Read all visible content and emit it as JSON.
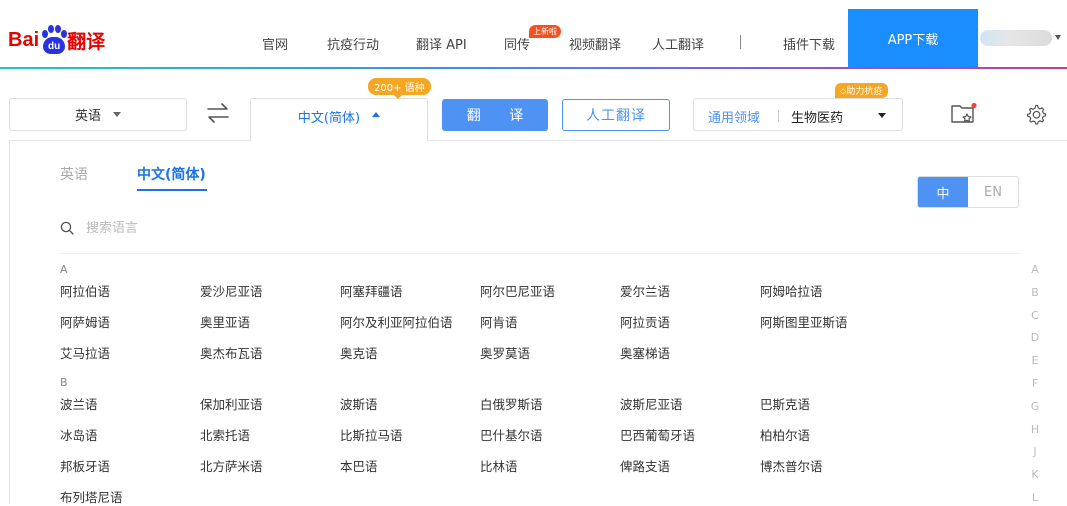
{
  "logo": {
    "bai": "Bai",
    "du": "du",
    "fanyi": "翻译"
  },
  "nav": {
    "items": [
      "官网",
      "抗疫行动",
      "翻译 API",
      "同传",
      "视频翻译",
      "人工翻译",
      "插件下载"
    ],
    "new_badge": "上新啦",
    "app_download": "APP下载"
  },
  "toolbar": {
    "source_lang": "英语",
    "target_lang": "中文(简体)",
    "lang_count_badge": "200+ 语种",
    "translate_label": "翻 译",
    "human_label": "人工翻译",
    "domain_label": "通用领域",
    "domain_value": "生物医药",
    "help_badge": "助力抗疫"
  },
  "panel": {
    "tabs": [
      "英语",
      "中文(简体)"
    ],
    "toggle": {
      "zh": "中",
      "en": "EN"
    },
    "search_placeholder": "搜索语言",
    "groups": [
      {
        "letter": "A",
        "rows": [
          [
            "阿拉伯语",
            "爱沙尼亚语",
            "阿塞拜疆语",
            "阿尔巴尼亚语",
            "爱尔兰语",
            "阿姆哈拉语"
          ],
          [
            "阿萨姆语",
            "奥里亚语",
            "阿尔及利亚阿拉伯语",
            "阿肯语",
            "阿拉贡语",
            "阿斯图里亚斯语"
          ],
          [
            "艾马拉语",
            "奥杰布瓦语",
            "奥克语",
            "奥罗莫语",
            "奥塞梯语"
          ]
        ]
      },
      {
        "letter": "B",
        "rows": [
          [
            "波兰语",
            "保加利亚语",
            "波斯语",
            "白俄罗斯语",
            "波斯尼亚语",
            "巴斯克语"
          ],
          [
            "冰岛语",
            "北索托语",
            "比斯拉马语",
            "巴什基尔语",
            "巴西葡萄牙语",
            "柏柏尔语"
          ],
          [
            "邦板牙语",
            "北方萨米语",
            "本巴语",
            "比林语",
            "俾路支语",
            "博杰普尔语"
          ],
          [
            "布列塔尼语"
          ]
        ]
      }
    ],
    "alphabet": [
      "A",
      "B",
      "C",
      "D",
      "E",
      "F",
      "G",
      "H",
      "J",
      "K",
      "L"
    ]
  },
  "colors": {
    "accent": "#4e92f4",
    "brand_red": "#e10601",
    "app_blue": "#1a8dff",
    "badge_orange": "#f5a623"
  }
}
